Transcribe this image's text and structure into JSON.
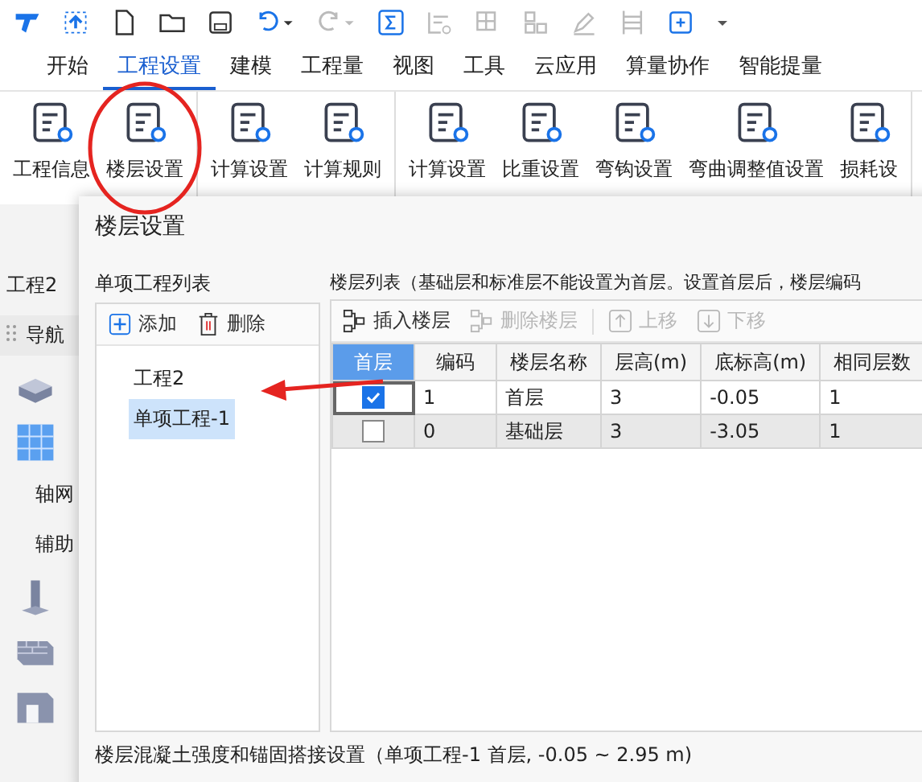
{
  "menu_tabs": [
    {
      "label": "开始",
      "selected": false
    },
    {
      "label": "工程设置",
      "selected": true
    },
    {
      "label": "建模",
      "selected": false
    },
    {
      "label": "工程量",
      "selected": false
    },
    {
      "label": "视图",
      "selected": false
    },
    {
      "label": "工具",
      "selected": false
    },
    {
      "label": "云应用",
      "selected": false
    },
    {
      "label": "算量协作",
      "selected": false
    },
    {
      "label": "智能提量",
      "selected": false
    }
  ],
  "ribbon": {
    "groups": [
      {
        "buttons": [
          {
            "label": "工程信息"
          },
          {
            "label": "楼层设置"
          }
        ]
      },
      {
        "buttons": [
          {
            "label": "计算设置"
          },
          {
            "label": "计算规则"
          }
        ]
      },
      {
        "buttons": [
          {
            "label": "计算设置"
          },
          {
            "label": "比重设置"
          },
          {
            "label": "弯钩设置"
          },
          {
            "label": "弯曲调整值设置"
          },
          {
            "label": "损耗设"
          }
        ]
      }
    ]
  },
  "app_panel": {
    "project_tab": "工程2",
    "nav_label": "导航",
    "items": [
      "轴网",
      "辅助"
    ]
  },
  "dialog": {
    "title": "楼层设置",
    "project_list": {
      "label": "单项工程列表",
      "toolbar": [
        {
          "label": "添加",
          "kind": "add"
        },
        {
          "label": "删除",
          "kind": "delete"
        }
      ],
      "tree": [
        {
          "label": "工程2",
          "selected": false
        },
        {
          "label": "单项工程-1",
          "selected": true
        }
      ]
    },
    "floor_list": {
      "label": "楼层列表（基础层和标准层不能设置为首层。设置首层后，楼层编码",
      "toolbar": [
        {
          "label": "插入楼层",
          "kind": "insert",
          "disabled": false
        },
        {
          "label": "删除楼层",
          "kind": "delete",
          "disabled": true
        },
        {
          "label": "上移",
          "kind": "up",
          "disabled": true
        },
        {
          "label": "下移",
          "kind": "down",
          "disabled": true
        }
      ],
      "columns": [
        {
          "label": "首层",
          "selected": true
        },
        {
          "label": "编码",
          "selected": false
        },
        {
          "label": "楼层名称",
          "selected": false
        },
        {
          "label": "层高(m)",
          "selected": false
        },
        {
          "label": "底标高(m)",
          "selected": false
        },
        {
          "label": "相同层数",
          "selected": false
        }
      ],
      "rows": [
        {
          "first_floor": true,
          "selected": false,
          "cells": [
            "",
            "1",
            "首层",
            "3",
            "-0.05",
            "1"
          ]
        },
        {
          "first_floor": false,
          "selected": true,
          "cells": [
            "",
            "0",
            "基础层",
            "3",
            "-3.05",
            "1"
          ]
        }
      ]
    },
    "status": "楼层混凝土强度和锚固搭接设置（单项工程-1  首层, -0.05 ~ 2.95 m)"
  }
}
